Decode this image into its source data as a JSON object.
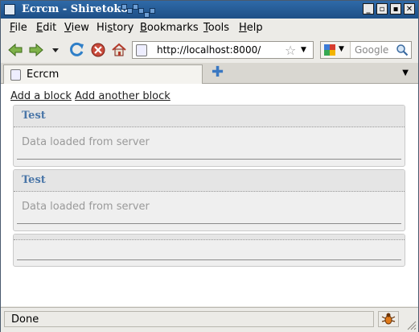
{
  "window": {
    "title": "Ecrcm - Shiretoko",
    "controls": [
      "_",
      "▫",
      "▪",
      "✕"
    ]
  },
  "menu": [
    "File",
    "Edit",
    "View",
    "History",
    "Bookmarks",
    "Tools",
    "Help"
  ],
  "menu_accel": [
    "F",
    "E",
    "V",
    "s",
    "B",
    "T",
    "H"
  ],
  "toolbar": {
    "url": "http://localhost:8000/",
    "search_placeholder": "Google",
    "icons": [
      "back-arrow-icon",
      "forward-arrow-icon",
      "history-dropdown-icon",
      "reload-icon",
      "stop-icon",
      "home-icon"
    ]
  },
  "tabs": [
    {
      "label": "Ecrcm"
    }
  ],
  "page": {
    "links": [
      "Add a block",
      "Add another block"
    ],
    "blocks": [
      {
        "title": "Test",
        "body": "Data loaded from server"
      },
      {
        "title": "Test",
        "body": "Data loaded from server"
      },
      {
        "title": "",
        "body": ""
      }
    ]
  },
  "status": {
    "text": "Done"
  }
}
